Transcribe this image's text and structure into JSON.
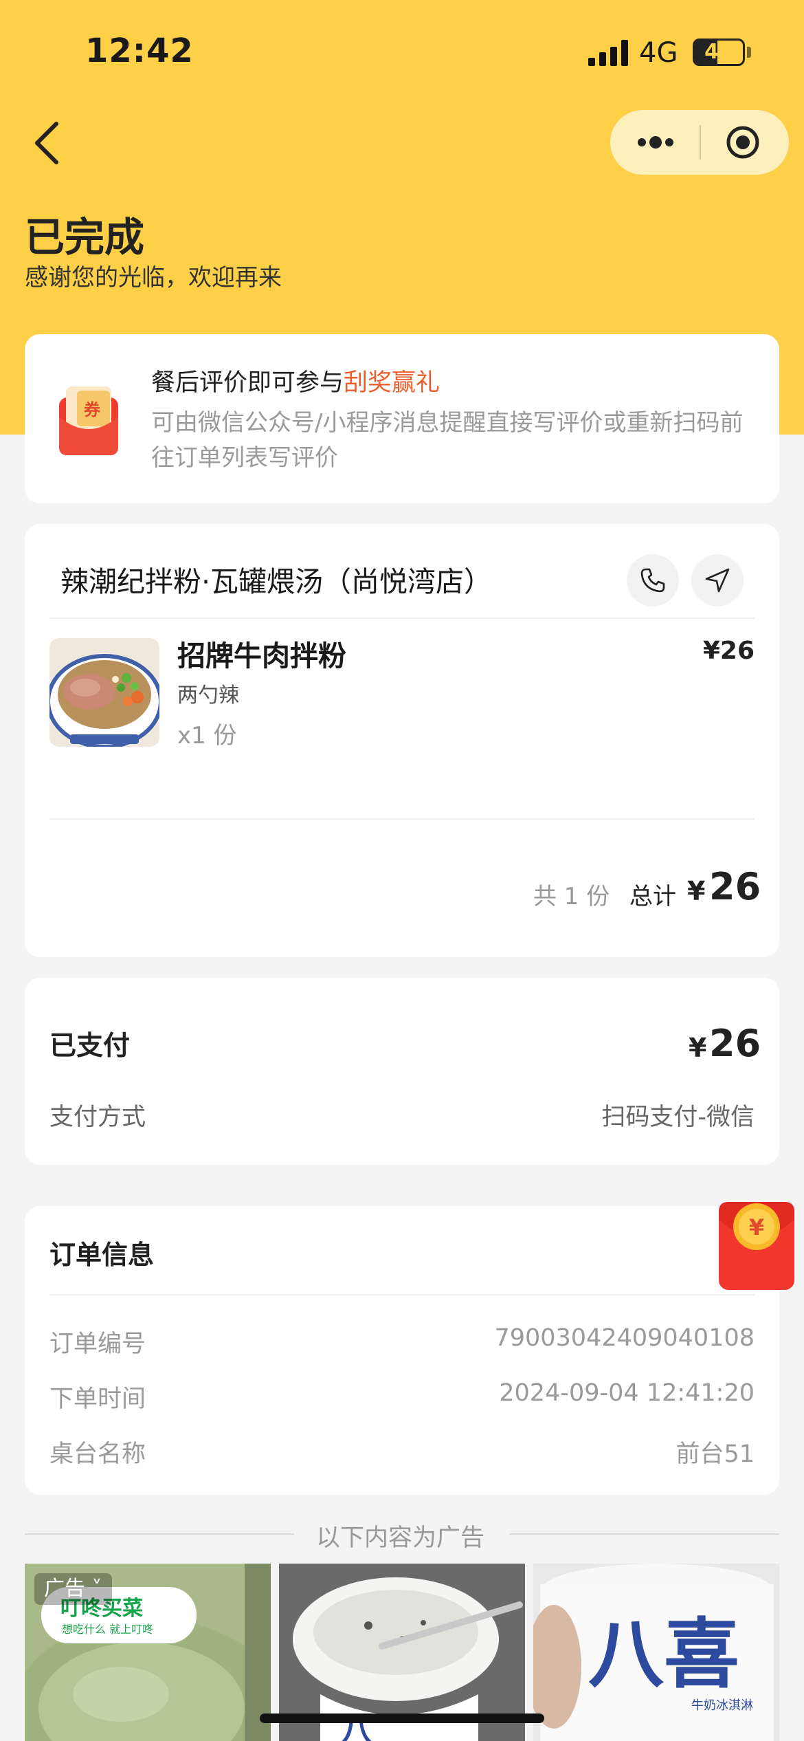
{
  "status_bar": {
    "time": "12:42",
    "network": "4G",
    "battery": "47",
    "battery_level": 0.47
  },
  "header": {
    "title": "已完成",
    "subtitle": "感谢您的光临，欢迎再来"
  },
  "review": {
    "title_prefix": "餐后评价即可参与",
    "title_highlight": "刮奖赢礼",
    "description": "可由微信公众号/小程序消息提醒直接写评价或重新扫码前往订单列表写评价",
    "icon_text": "券"
  },
  "order": {
    "shop_name": "辣潮纪拌粉·瓦罐煨汤（尚悦湾店）",
    "items": [
      {
        "name": "招牌牛肉拌粉",
        "spec": "两勺辣",
        "qty": "x1 份",
        "price": "¥26"
      }
    ],
    "count_text": "共 1 份",
    "total_label": "总计",
    "currency": "¥",
    "total": "26"
  },
  "payment": {
    "paid_label": "已支付",
    "currency": "¥",
    "amount": "26",
    "method_label": "支付方式",
    "method_value": "扫码支付-微信"
  },
  "order_info": {
    "title": "订单信息",
    "rows": [
      {
        "label": "订单编号",
        "value": "79003042409040108"
      },
      {
        "label": "下单时间",
        "value": "2024-09-04 12:41:20"
      },
      {
        "label": "桌台名称",
        "value": "前台51"
      }
    ]
  },
  "ads": {
    "separator": "以下内容为广告",
    "badge": "广告",
    "logo_main": "叮咚买菜",
    "logo_sub": "想吃什么 就上叮咚",
    "brand_text": "八喜",
    "brand_sub": "牛奶冰淇淋"
  },
  "colors": {
    "brand_yellow": "#fdd047",
    "highlight": "#ec5d2c",
    "red_packet": "#f1372d"
  }
}
